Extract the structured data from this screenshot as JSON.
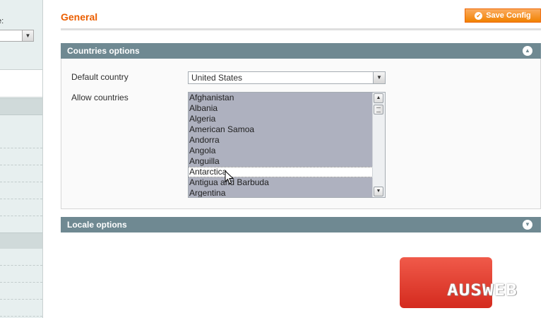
{
  "sidebar": {
    "scope_label_fragment": "e:"
  },
  "header": {
    "title": "General",
    "save_button": "Save Config"
  },
  "countries_options": {
    "title": "Countries options",
    "default_country": {
      "label": "Default country",
      "value": "United States"
    },
    "allow_countries": {
      "label": "Allow countries",
      "options": [
        "Afghanistan",
        "Albania",
        "Algeria",
        "American Samoa",
        "Andorra",
        "Angola",
        "Anguilla",
        "Antarctica",
        "Antigua and Barbuda",
        "Argentina"
      ],
      "hovered": "Antarctica"
    }
  },
  "locale_options": {
    "title": "Locale options"
  },
  "watermark": {
    "text": "AUSWEB"
  },
  "colors": {
    "accent": "#eb5e00",
    "section_header": "#6f8992",
    "selected_option": "#aeb1bf",
    "logo": "#e23b2e"
  }
}
